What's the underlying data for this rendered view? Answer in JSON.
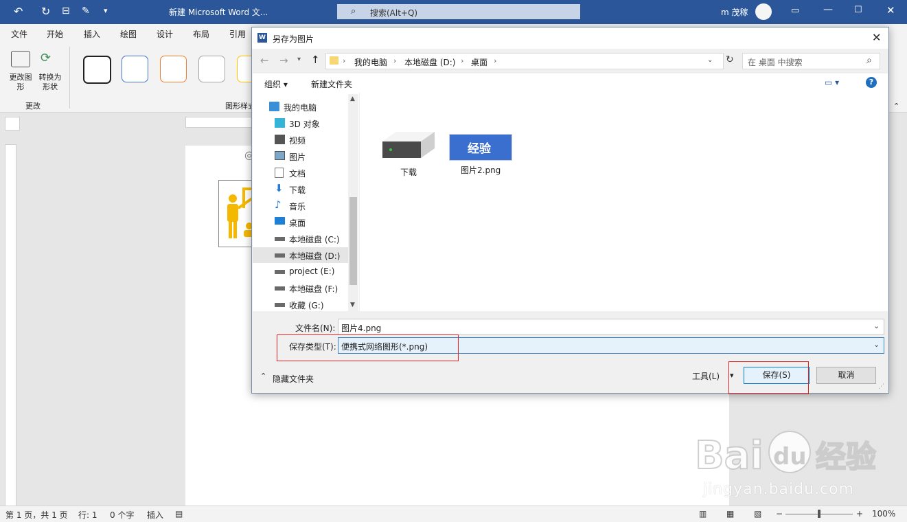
{
  "window": {
    "title": "新建 Microsoft Word 文...",
    "search_placeholder": "搜索(Alt+Q)",
    "user_name": "m 茂稼"
  },
  "ribbon": {
    "tabs": [
      "文件",
      "开始",
      "插入",
      "绘图",
      "设计",
      "布局",
      "引用"
    ],
    "change_shape_label": "更改图形",
    "convert_label": "转换为形状",
    "group_change_label": "更改",
    "group_styles_label": "图形样式",
    "swatch_colors": [
      "#222222",
      "#4472c4",
      "#ed7d31",
      "#a5a5a5",
      "#ffc000"
    ]
  },
  "statusbar": {
    "page": "第 1 页，共 1 页",
    "line": "行: 1",
    "words": "0 个字",
    "mode": "插入",
    "zoom": "100%"
  },
  "dialog": {
    "title": "另存为图片",
    "breadcrumb": [
      "我的电脑",
      "本地磁盘 (D:)",
      "桌面"
    ],
    "search_placeholder": "在 桌面 中搜索",
    "organize_label": "组织 ▾",
    "new_folder_label": "新建文件夹",
    "nav_items": [
      {
        "label": "我的电脑",
        "icon": "computer-icon"
      },
      {
        "label": "3D 对象",
        "icon": "3d-objects-icon"
      },
      {
        "label": "视频",
        "icon": "video-icon"
      },
      {
        "label": "图片",
        "icon": "pictures-icon"
      },
      {
        "label": "文档",
        "icon": "documents-icon"
      },
      {
        "label": "下载",
        "icon": "download-icon"
      },
      {
        "label": "音乐",
        "icon": "music-icon"
      },
      {
        "label": "桌面",
        "icon": "desktop-icon"
      },
      {
        "label": "本地磁盘 (C:)",
        "icon": "drive-icon"
      },
      {
        "label": "本地磁盘 (D:)",
        "icon": "drive-icon",
        "selected": true
      },
      {
        "label": "project (E:)",
        "icon": "drive-icon"
      },
      {
        "label": "本地磁盘 (F:)",
        "icon": "drive-icon"
      },
      {
        "label": "收藏 (G:)",
        "icon": "drive-icon"
      }
    ],
    "files": [
      {
        "name": "下载",
        "icon": "drive-icon"
      },
      {
        "name": "图片2.png",
        "icon": "image-thumbnail",
        "thumb_text": "经验"
      }
    ],
    "filename_label": "文件名(N):",
    "filename_value": "图片4.png",
    "filetype_label": "保存类型(T):",
    "filetype_value": "便携式网络图形(*.png)",
    "hide_folders_label": "隐藏文件夹",
    "tools_label": "工具(L)",
    "save_label": "保存(S)",
    "cancel_label": "取消"
  },
  "watermark": {
    "logo_text": "Bai du 经验",
    "url": "jingyan.baidu.com"
  }
}
